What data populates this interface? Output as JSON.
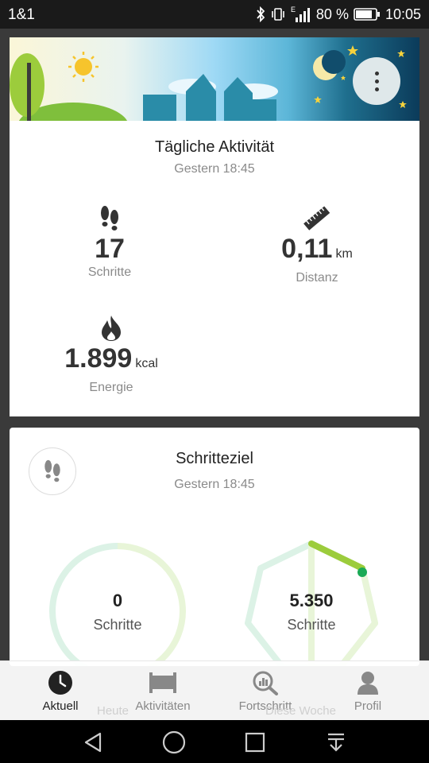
{
  "status": {
    "carrier": "1&1",
    "network": "E",
    "battery": "80 %",
    "time": "10:05"
  },
  "activity": {
    "title": "Tägliche Aktivität",
    "subtitle": "Gestern 18:45",
    "steps": {
      "value": "17",
      "label": "Schritte"
    },
    "distance": {
      "value": "0,11",
      "unit": "km",
      "label": "Distanz"
    },
    "energy": {
      "value": "1.899",
      "unit": "kcal",
      "label": "Energie"
    }
  },
  "goal": {
    "title": "Schritteziel",
    "subtitle": "Gestern 18:45",
    "today": {
      "value": "0",
      "label": "Schritte",
      "caption": "Heute",
      "progress": 0
    },
    "week": {
      "value": "5.350",
      "label": "Schritte",
      "caption": "Diese Woche",
      "progress": 0.12
    }
  },
  "nav": {
    "items": [
      {
        "label": "Aktuell",
        "icon": "clock-icon",
        "active": true
      },
      {
        "label": "Aktivitäten",
        "icon": "bed-icon",
        "active": false
      },
      {
        "label": "Fortschritt",
        "icon": "chart-search-icon",
        "active": false
      },
      {
        "label": "Profil",
        "icon": "person-icon",
        "active": false
      }
    ]
  },
  "colors": {
    "accent": "#9ccc3c",
    "ring_track_light": "#dcf2e6",
    "ring_track_green": "#e8f5d8",
    "progress_dot": "#1aaa55",
    "banner_teal": "#2a8ca8"
  }
}
